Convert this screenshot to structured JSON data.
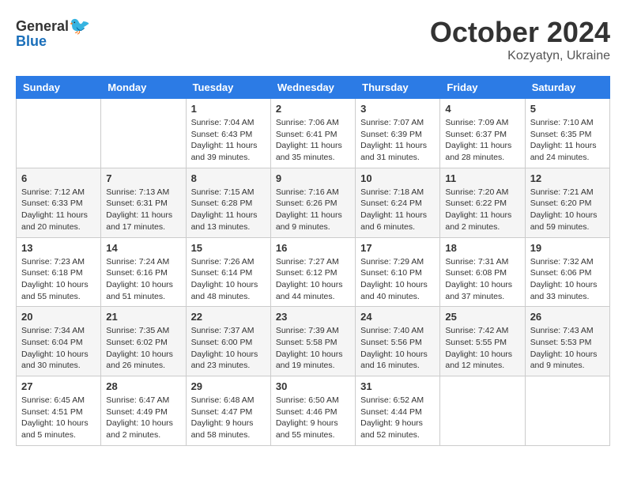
{
  "logo": {
    "general": "General",
    "blue": "Blue"
  },
  "title": "October 2024",
  "subtitle": "Kozyatyn, Ukraine",
  "days_header": [
    "Sunday",
    "Monday",
    "Tuesday",
    "Wednesday",
    "Thursday",
    "Friday",
    "Saturday"
  ],
  "weeks": [
    [
      {
        "day": "",
        "info": ""
      },
      {
        "day": "",
        "info": ""
      },
      {
        "day": "1",
        "info": "Sunrise: 7:04 AM\nSunset: 6:43 PM\nDaylight: 11 hours and 39 minutes."
      },
      {
        "day": "2",
        "info": "Sunrise: 7:06 AM\nSunset: 6:41 PM\nDaylight: 11 hours and 35 minutes."
      },
      {
        "day": "3",
        "info": "Sunrise: 7:07 AM\nSunset: 6:39 PM\nDaylight: 11 hours and 31 minutes."
      },
      {
        "day": "4",
        "info": "Sunrise: 7:09 AM\nSunset: 6:37 PM\nDaylight: 11 hours and 28 minutes."
      },
      {
        "day": "5",
        "info": "Sunrise: 7:10 AM\nSunset: 6:35 PM\nDaylight: 11 hours and 24 minutes."
      }
    ],
    [
      {
        "day": "6",
        "info": "Sunrise: 7:12 AM\nSunset: 6:33 PM\nDaylight: 11 hours and 20 minutes."
      },
      {
        "day": "7",
        "info": "Sunrise: 7:13 AM\nSunset: 6:31 PM\nDaylight: 11 hours and 17 minutes."
      },
      {
        "day": "8",
        "info": "Sunrise: 7:15 AM\nSunset: 6:28 PM\nDaylight: 11 hours and 13 minutes."
      },
      {
        "day": "9",
        "info": "Sunrise: 7:16 AM\nSunset: 6:26 PM\nDaylight: 11 hours and 9 minutes."
      },
      {
        "day": "10",
        "info": "Sunrise: 7:18 AM\nSunset: 6:24 PM\nDaylight: 11 hours and 6 minutes."
      },
      {
        "day": "11",
        "info": "Sunrise: 7:20 AM\nSunset: 6:22 PM\nDaylight: 11 hours and 2 minutes."
      },
      {
        "day": "12",
        "info": "Sunrise: 7:21 AM\nSunset: 6:20 PM\nDaylight: 10 hours and 59 minutes."
      }
    ],
    [
      {
        "day": "13",
        "info": "Sunrise: 7:23 AM\nSunset: 6:18 PM\nDaylight: 10 hours and 55 minutes."
      },
      {
        "day": "14",
        "info": "Sunrise: 7:24 AM\nSunset: 6:16 PM\nDaylight: 10 hours and 51 minutes."
      },
      {
        "day": "15",
        "info": "Sunrise: 7:26 AM\nSunset: 6:14 PM\nDaylight: 10 hours and 48 minutes."
      },
      {
        "day": "16",
        "info": "Sunrise: 7:27 AM\nSunset: 6:12 PM\nDaylight: 10 hours and 44 minutes."
      },
      {
        "day": "17",
        "info": "Sunrise: 7:29 AM\nSunset: 6:10 PM\nDaylight: 10 hours and 40 minutes."
      },
      {
        "day": "18",
        "info": "Sunrise: 7:31 AM\nSunset: 6:08 PM\nDaylight: 10 hours and 37 minutes."
      },
      {
        "day": "19",
        "info": "Sunrise: 7:32 AM\nSunset: 6:06 PM\nDaylight: 10 hours and 33 minutes."
      }
    ],
    [
      {
        "day": "20",
        "info": "Sunrise: 7:34 AM\nSunset: 6:04 PM\nDaylight: 10 hours and 30 minutes."
      },
      {
        "day": "21",
        "info": "Sunrise: 7:35 AM\nSunset: 6:02 PM\nDaylight: 10 hours and 26 minutes."
      },
      {
        "day": "22",
        "info": "Sunrise: 7:37 AM\nSunset: 6:00 PM\nDaylight: 10 hours and 23 minutes."
      },
      {
        "day": "23",
        "info": "Sunrise: 7:39 AM\nSunset: 5:58 PM\nDaylight: 10 hours and 19 minutes."
      },
      {
        "day": "24",
        "info": "Sunrise: 7:40 AM\nSunset: 5:56 PM\nDaylight: 10 hours and 16 minutes."
      },
      {
        "day": "25",
        "info": "Sunrise: 7:42 AM\nSunset: 5:55 PM\nDaylight: 10 hours and 12 minutes."
      },
      {
        "day": "26",
        "info": "Sunrise: 7:43 AM\nSunset: 5:53 PM\nDaylight: 10 hours and 9 minutes."
      }
    ],
    [
      {
        "day": "27",
        "info": "Sunrise: 6:45 AM\nSunset: 4:51 PM\nDaylight: 10 hours and 5 minutes."
      },
      {
        "day": "28",
        "info": "Sunrise: 6:47 AM\nSunset: 4:49 PM\nDaylight: 10 hours and 2 minutes."
      },
      {
        "day": "29",
        "info": "Sunrise: 6:48 AM\nSunset: 4:47 PM\nDaylight: 9 hours and 58 minutes."
      },
      {
        "day": "30",
        "info": "Sunrise: 6:50 AM\nSunset: 4:46 PM\nDaylight: 9 hours and 55 minutes."
      },
      {
        "day": "31",
        "info": "Sunrise: 6:52 AM\nSunset: 4:44 PM\nDaylight: 9 hours and 52 minutes."
      },
      {
        "day": "",
        "info": ""
      },
      {
        "day": "",
        "info": ""
      }
    ]
  ]
}
